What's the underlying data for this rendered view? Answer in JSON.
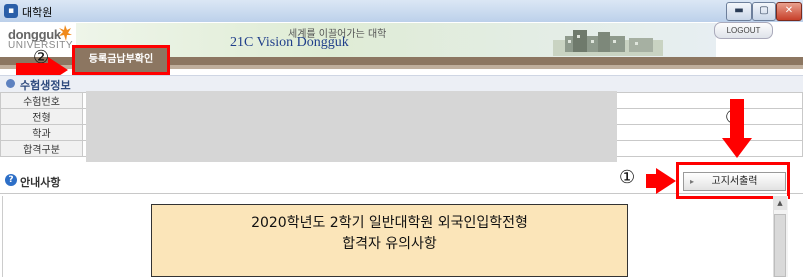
{
  "window": {
    "title": "대학원",
    "controls": [
      "minimize",
      "maximize",
      "close"
    ]
  },
  "header": {
    "logo_main": "dongguk",
    "logo_sub": "UNIVERSITY",
    "slogan": "세계를 이끌어가는 대학",
    "vision": "21C Vision Dongguk",
    "logout_label": "LOGOUT"
  },
  "menu": {
    "active_tab": "등록금납부확인"
  },
  "section": {
    "title": "수험생정보",
    "rows": [
      {
        "label": "수험번호",
        "value": ""
      },
      {
        "label": "전형",
        "value": ""
      },
      {
        "label": "학과",
        "value": ""
      },
      {
        "label": "합격구분",
        "value": ""
      }
    ]
  },
  "notice": {
    "title": "안내사항",
    "print_button_label": "고지서출력",
    "box_line1": "2020학년도 2학기 일반대학원 외국인입학전형",
    "box_line2": "합격자 유의사항"
  },
  "annotations": {
    "num1": "①",
    "num2": "②",
    "color": "#ff0000"
  }
}
